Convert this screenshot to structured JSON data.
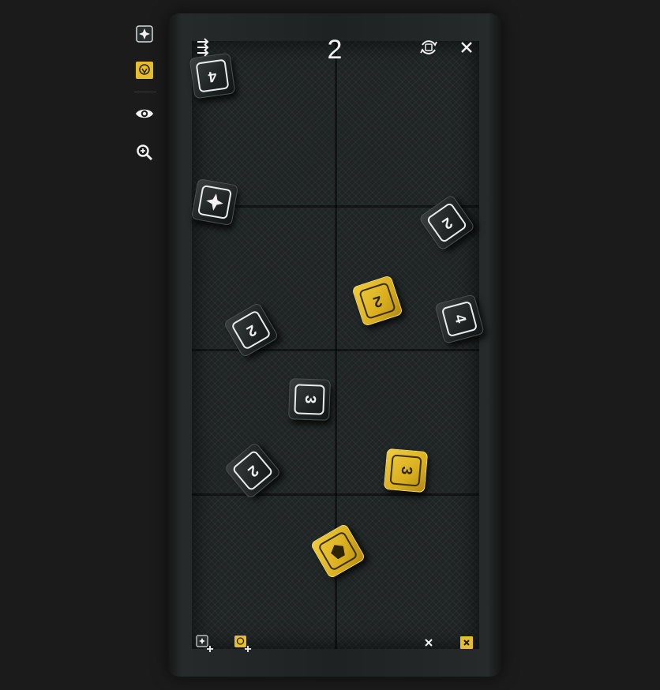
{
  "roll_total": "2",
  "colors": {
    "gold": "#e6bd2a",
    "dark_die": "#262a2b",
    "background": "#1b1b1b"
  },
  "rail": {
    "icons": [
      "dark-die-icon",
      "gold-die-icon",
      "eye-icon",
      "zoom-in-icon"
    ]
  },
  "toolbar": {
    "icons": [
      "shuffle-arrows-icon",
      "reroll-icon",
      "close-icon"
    ]
  },
  "dice": [
    {
      "set": "dark",
      "face": "4"
    },
    {
      "set": "dark",
      "face": "2"
    },
    {
      "set": "dark",
      "face": "2"
    },
    {
      "set": "dark",
      "face": "4"
    },
    {
      "set": "dark",
      "face": "3"
    },
    {
      "set": "dark",
      "face": "2"
    },
    {
      "set": "dark",
      "face": "symbol"
    },
    {
      "set": "gold",
      "face": "2"
    },
    {
      "set": "gold",
      "face": "3"
    },
    {
      "set": "gold",
      "face": "symbol"
    }
  ],
  "bottom_bar": {
    "icons": [
      "add-dark-die-icon",
      "add-gold-die-icon",
      "clear-dark-icon",
      "clear-gold-icon"
    ]
  }
}
